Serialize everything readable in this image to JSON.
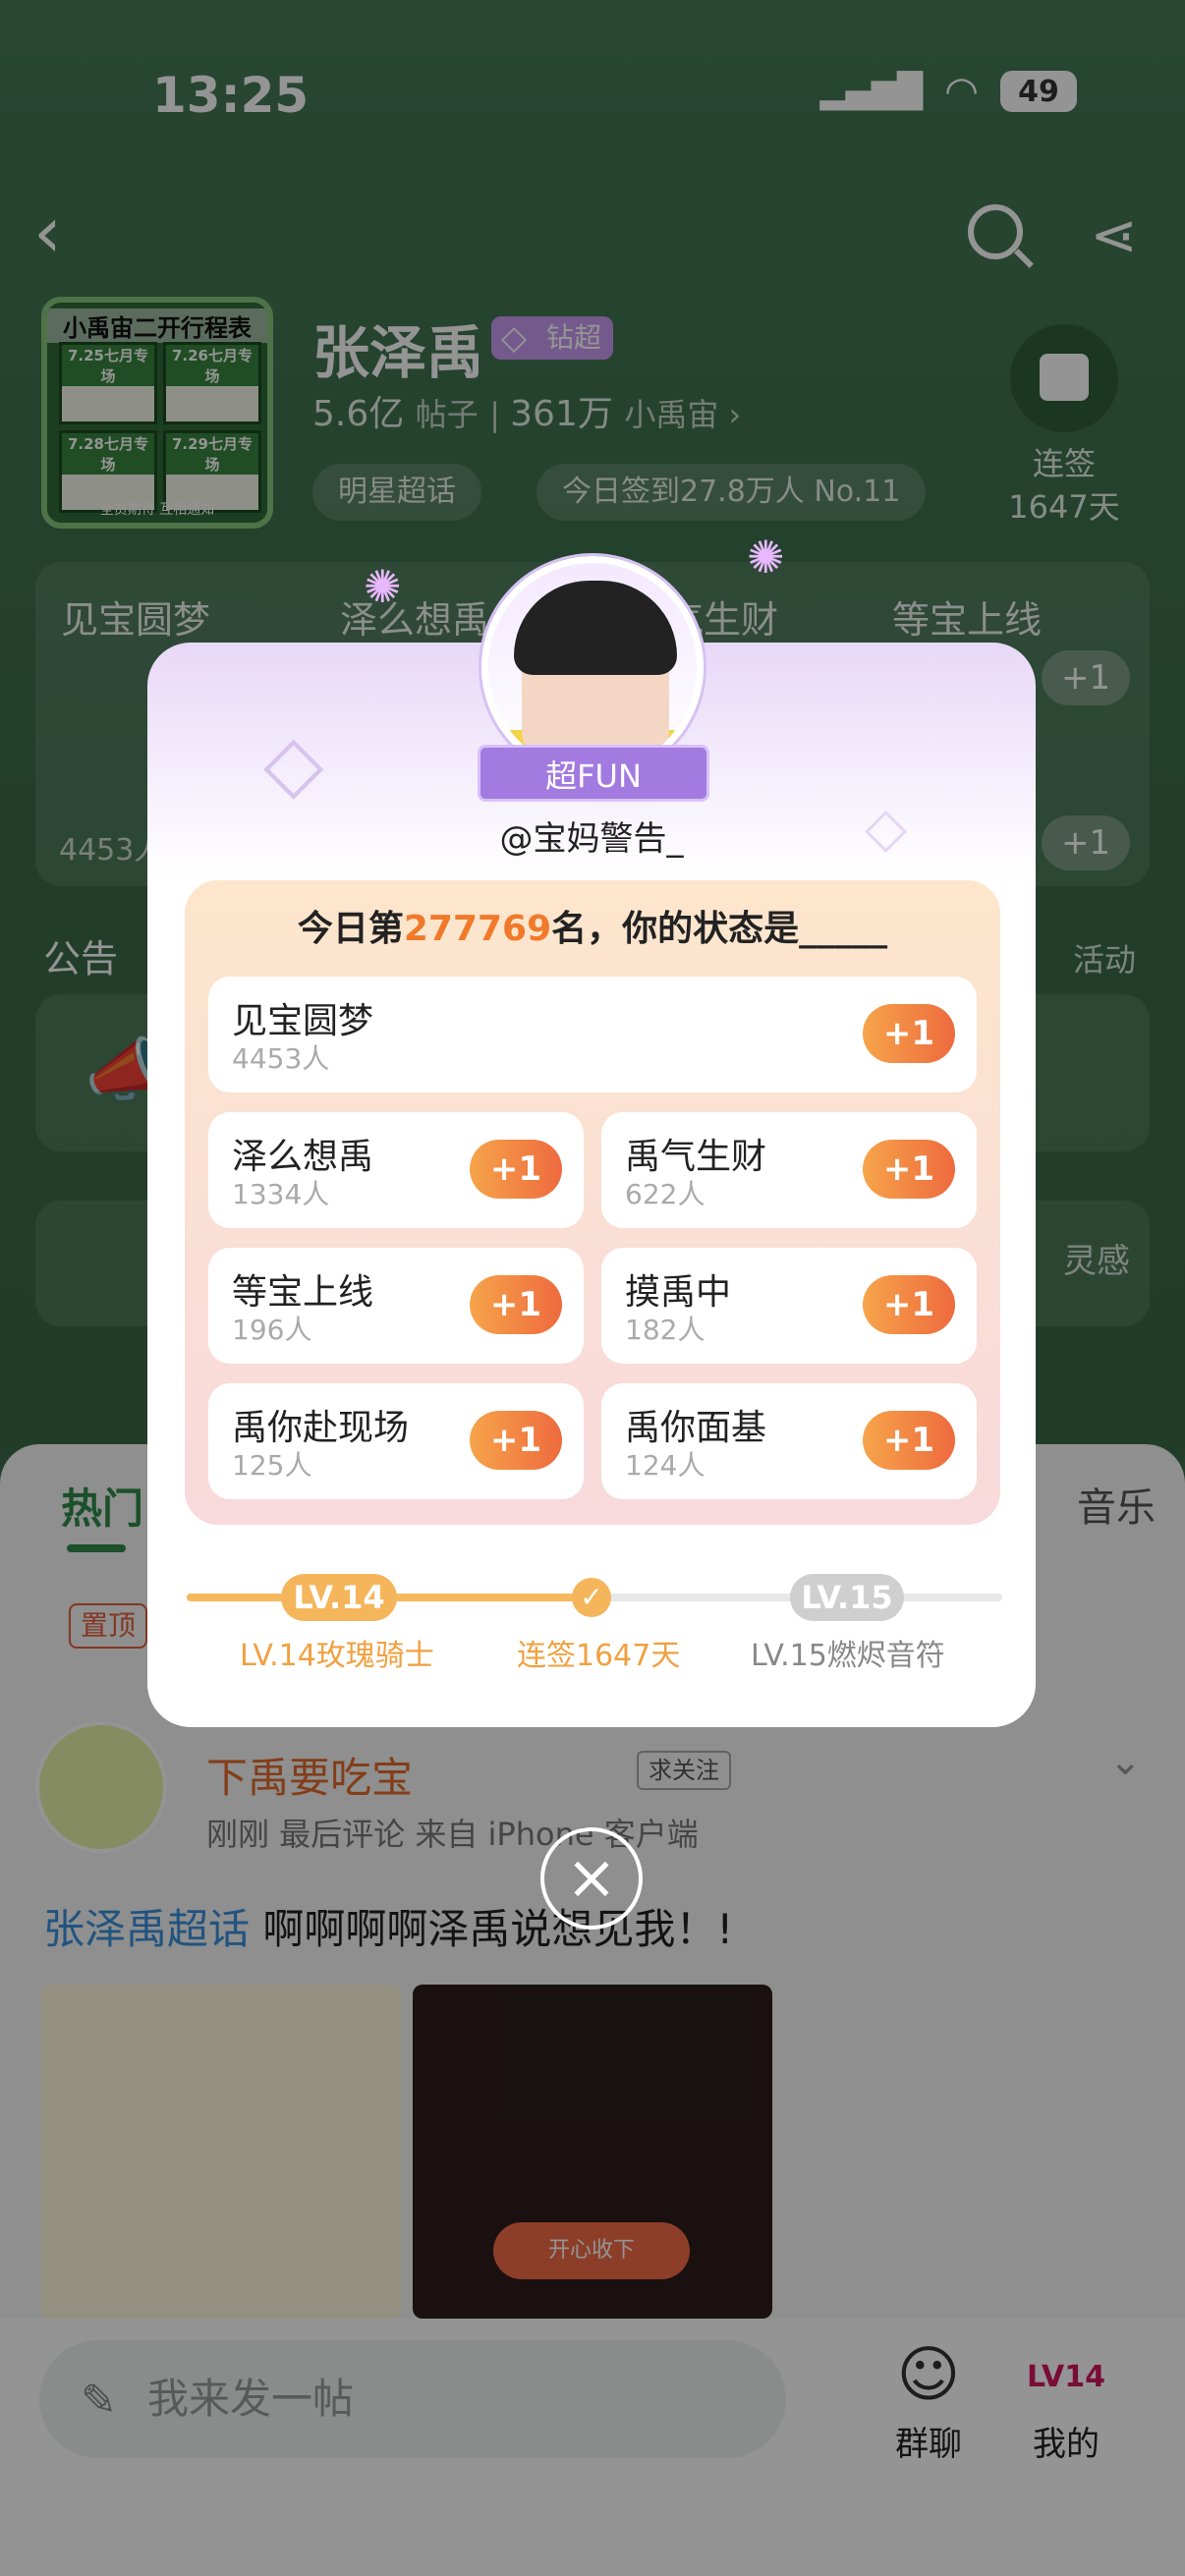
{
  "status_bar": {
    "time": "13:25",
    "battery": "49"
  },
  "topic": {
    "cover_title": "小禹宙二开行程表",
    "cover_cells": [
      "7.25七月专场",
      "7.26七月专场",
      "7.28七月专场",
      "7.29七月专场"
    ],
    "cover_footer": "全员期待 互相通知",
    "name": "张泽禹",
    "badge": "钻超",
    "posts_count": "5.6亿",
    "posts_label": "帖子",
    "fans_count": "361万",
    "fans_label": "小禹宙",
    "chips": [
      "明星超话",
      "今日签到27.8万人 No.11"
    ],
    "checkin_label": "连签",
    "checkin_days": "1647天"
  },
  "background_cards": {
    "row1": [
      "见宝圆梦",
      "泽么想禹",
      "禹气生财",
      "等宝上线"
    ],
    "stat": "4453人",
    "plus": "+1",
    "notice_label": "公告",
    "notice_right": "活动",
    "notice2_right": "灵感"
  },
  "feed": {
    "tab_hot": "热门",
    "tab_music": "音乐",
    "pin_tag": "置顶",
    "author": "下禹要吃宝",
    "follow": "求关注",
    "meta": "刚刚  最后评论  来自 iPhone 客户端",
    "topic_tag": "张泽禹超话",
    "text": "啊啊啊啊泽禹说想见我！!",
    "image2_button": "开心收下"
  },
  "bottom_bar": {
    "compose_placeholder": "我来发一帖",
    "group_label": "群聊",
    "me_label": "我的",
    "me_level": "LV14"
  },
  "modal": {
    "ribbon": "超FUN",
    "handle": "@宝妈警告_",
    "rank_prefix": "今日第",
    "rank": "277769",
    "rank_suffix": "名，你的状态是_____",
    "options": [
      {
        "name": "见宝圆梦",
        "count": "4453人",
        "plus": "+1"
      },
      {
        "name": "泽么想禹",
        "count": "1334人",
        "plus": "+1"
      },
      {
        "name": "禹气生财",
        "count": "622人",
        "plus": "+1"
      },
      {
        "name": "等宝上线",
        "count": "196人",
        "plus": "+1"
      },
      {
        "name": "摸禹中",
        "count": "182人",
        "plus": "+1"
      },
      {
        "name": "禹你赴现场",
        "count": "125人",
        "plus": "+1"
      },
      {
        "name": "禹你面基",
        "count": "124人",
        "plus": "+1"
      }
    ],
    "level_current": "LV.14",
    "level_next": "LV.15",
    "level_current_name": "LV.14玫瑰骑士",
    "level_mid": "连签1647天",
    "level_next_name": "LV.15燃烬音符",
    "colors": {
      "accent": "#f07a2a",
      "purple": "#a37ae0",
      "green": "#3d6b4c"
    }
  }
}
